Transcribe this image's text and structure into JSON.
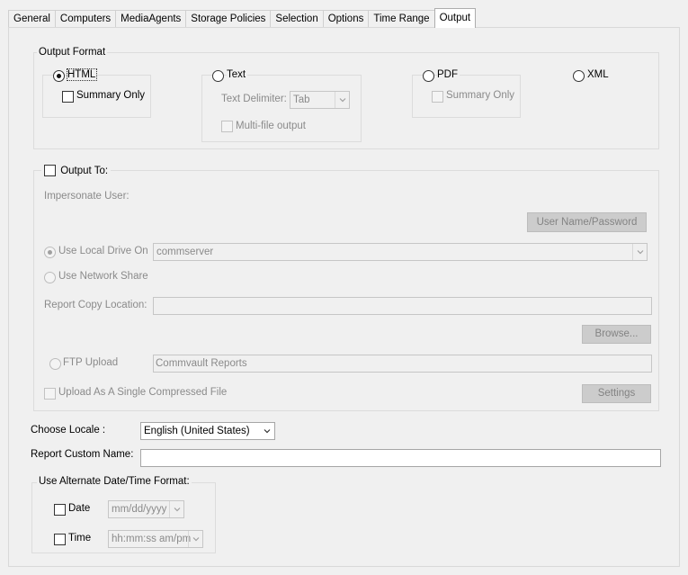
{
  "tabs": [
    "General",
    "Computers",
    "MediaAgents",
    "Storage Policies",
    "Selection",
    "Options",
    "Time Range",
    "Output"
  ],
  "output_format": {
    "title": "Output Format",
    "html_label": "HTML",
    "summary_only_label": "Summary Only",
    "text_label": "Text",
    "text_delimiter_label": "Text Delimiter:",
    "text_delimiter_value": "Tab",
    "multi_file_label": "Multi-file output",
    "pdf_label": "PDF",
    "pdf_summary_only_label": "Summary Only",
    "xml_label": "XML"
  },
  "output_to": {
    "title": "Output To:",
    "impersonate_user_label": "Impersonate User:",
    "user_password_button": "User Name/Password",
    "use_local_drive_label": "Use Local Drive On",
    "local_drive_value": "commserver",
    "use_network_share_label": "Use Network Share",
    "report_copy_location_label": "Report Copy Location:",
    "report_copy_location_value": "",
    "browse_button": "Browse...",
    "ftp_upload_label": "FTP Upload",
    "ftp_upload_value": "Commvault Reports",
    "single_compressed_label": "Upload As A Single Compressed File",
    "settings_button": "Settings"
  },
  "locale": {
    "label": "Choose Locale :",
    "value": "English (United States)"
  },
  "custom_name": {
    "label": "Report Custom Name:",
    "value": ""
  },
  "date_time": {
    "title": "Use Alternate Date/Time Format:",
    "date_label": "Date",
    "date_format": "mm/dd/yyyy",
    "time_label": "Time",
    "time_format": "hh:mm:ss am/pm"
  },
  "colors": {
    "panel_bg": "#f0f0f0",
    "active_tab_bg": "#ffffff",
    "disabled_text": "#8a8a8a"
  }
}
